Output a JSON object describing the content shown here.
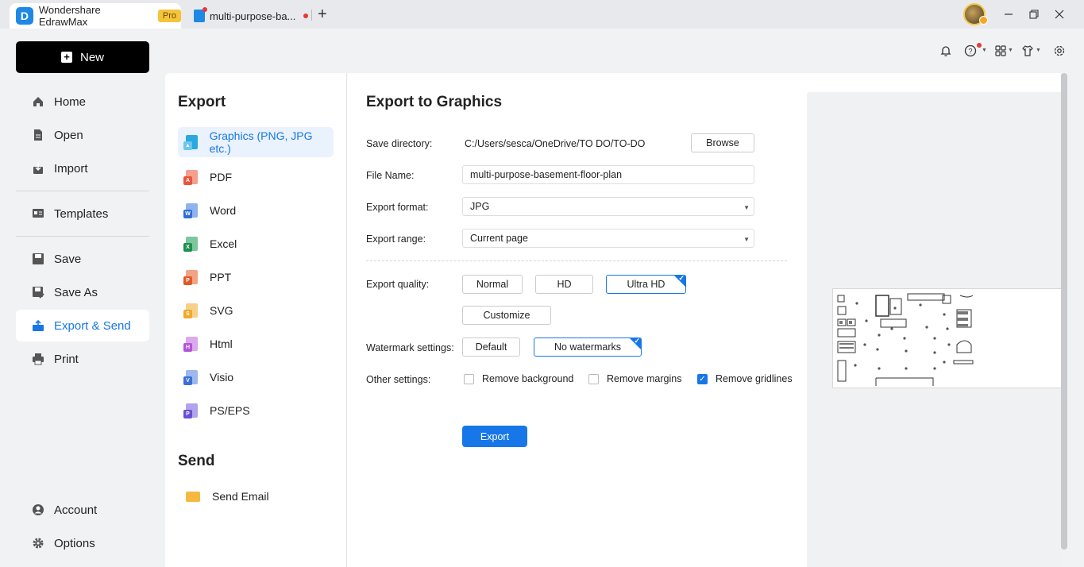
{
  "titlebar": {
    "app_name": "Wondershare EdrawMax",
    "pro_label": "Pro",
    "doc_tab": "multi-purpose-ba...",
    "new_tab_icon": "plus-icon",
    "window_controls": [
      "minimize-icon",
      "restore-icon",
      "close-icon"
    ]
  },
  "toolbar": {
    "icons": [
      "bell-icon",
      "help-icon",
      "apps-icon",
      "shirt-icon",
      "settings-icon"
    ]
  },
  "sidebar": {
    "new_label": "New",
    "items": [
      {
        "label": "Home",
        "icon": "home-icon"
      },
      {
        "label": "Open",
        "icon": "open-file-icon"
      },
      {
        "label": "Import",
        "icon": "import-icon"
      },
      {
        "label": "Templates",
        "icon": "templates-icon"
      },
      {
        "label": "Save",
        "icon": "save-icon"
      },
      {
        "label": "Save As",
        "icon": "save-as-icon"
      },
      {
        "label": "Export & Send",
        "icon": "export-icon",
        "active": true
      },
      {
        "label": "Print",
        "icon": "print-icon"
      },
      {
        "label": "Account",
        "icon": "account-icon"
      },
      {
        "label": "Options",
        "icon": "gear-icon"
      }
    ]
  },
  "export_panel": {
    "export_title": "Export",
    "formats": [
      {
        "label": "Graphics (PNG, JPG etc.)",
        "icon": "image-file-icon",
        "color": "#29a9e0",
        "active": true
      },
      {
        "label": "PDF",
        "icon": "pdf-file-icon",
        "color": "#e8553c"
      },
      {
        "label": "Word",
        "icon": "word-file-icon",
        "color": "#2f6fd6"
      },
      {
        "label": "Excel",
        "icon": "excel-file-icon",
        "color": "#1f8f4e"
      },
      {
        "label": "PPT",
        "icon": "ppt-file-icon",
        "color": "#e0592a"
      },
      {
        "label": "SVG",
        "icon": "svg-file-icon",
        "color": "#f0a92b"
      },
      {
        "label": "Html",
        "icon": "html-file-icon",
        "color": "#b354d6"
      },
      {
        "label": "Visio",
        "icon": "visio-file-icon",
        "color": "#3a6fd8"
      },
      {
        "label": "PS/EPS",
        "icon": "ps-eps-file-icon",
        "color": "#6a4fd4"
      }
    ],
    "send_title": "Send",
    "send_items": [
      {
        "label": "Send Email",
        "icon": "envelope-icon",
        "color": "#f5b942"
      }
    ]
  },
  "form": {
    "title": "Export to Graphics",
    "save_directory_label": "Save directory:",
    "save_directory_value": "C:/Users/sesca/OneDrive/TO DO/TO-DO",
    "browse_label": "Browse",
    "file_name_label": "File Name:",
    "file_name_value": "multi-purpose-basement-floor-plan",
    "export_format_label": "Export format:",
    "export_format_value": "JPG",
    "export_range_label": "Export range:",
    "export_range_value": "Current page",
    "export_quality_label": "Export quality:",
    "quality_options": [
      "Normal",
      "HD",
      "Ultra HD"
    ],
    "quality_selected": "Ultra HD",
    "customize_label": "Customize",
    "watermark_label": "Watermark settings:",
    "watermark_options": [
      "Default",
      "No watermarks"
    ],
    "watermark_selected": "No watermarks",
    "other_settings_label": "Other settings:",
    "checkboxes": [
      {
        "label": "Remove background",
        "checked": false
      },
      {
        "label": "Remove margins",
        "checked": false
      },
      {
        "label": "Remove gridlines",
        "checked": true
      }
    ],
    "export_button": "Export"
  },
  "colors": {
    "accent": "#1777e8",
    "active_bg": "#eaf2fd",
    "new_button_bg": "#000000",
    "pro_badge": "#f5c43a"
  }
}
